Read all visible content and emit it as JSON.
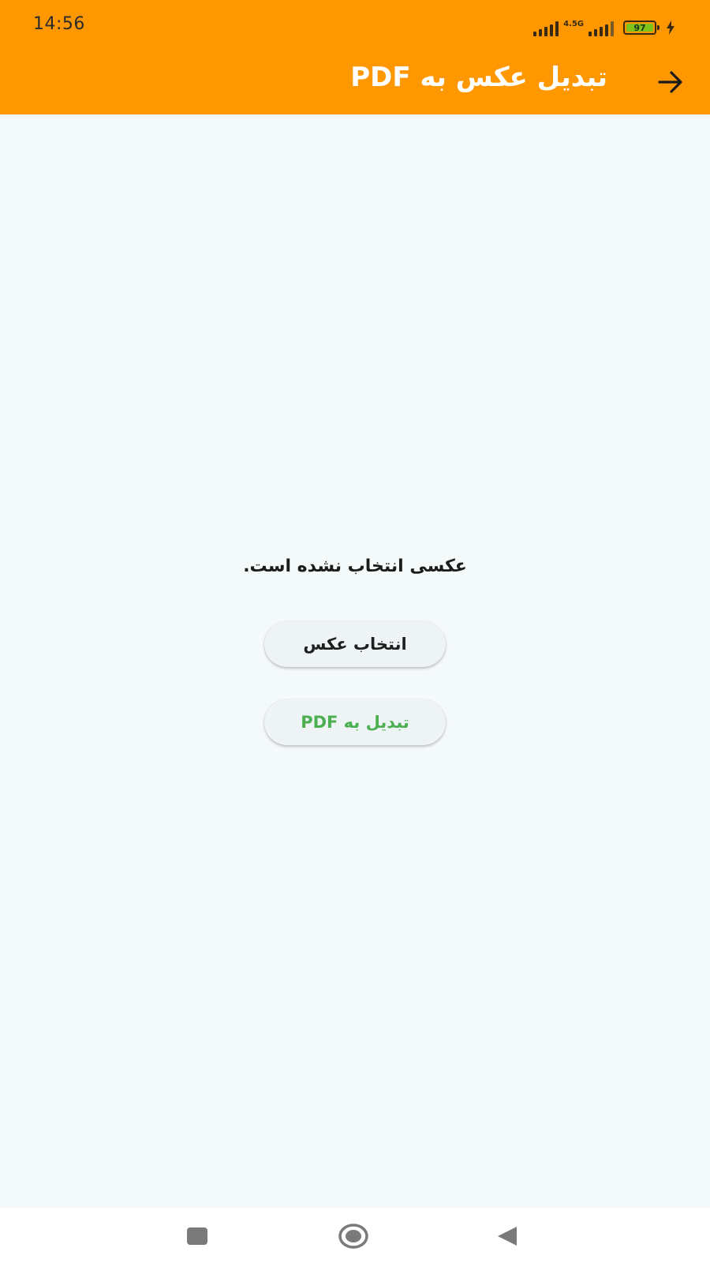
{
  "status_bar": {
    "time": "14:56",
    "network": "4.5G",
    "battery": "97"
  },
  "app_bar": {
    "title": "تبدیل عکس به PDF",
    "back_icon": "arrow-forward-icon"
  },
  "main": {
    "empty_message": "عکسی انتخاب نشده است.",
    "select_button_label": "انتخاب عکس",
    "convert_button_label": "تبدیل به PDF"
  },
  "colors": {
    "app_bar": "#ff9800",
    "background": "#f4f9fa",
    "convert_text": "#4caf50"
  },
  "nav_bar": {
    "icons": [
      "recents-icon",
      "home-icon",
      "back-icon"
    ]
  }
}
